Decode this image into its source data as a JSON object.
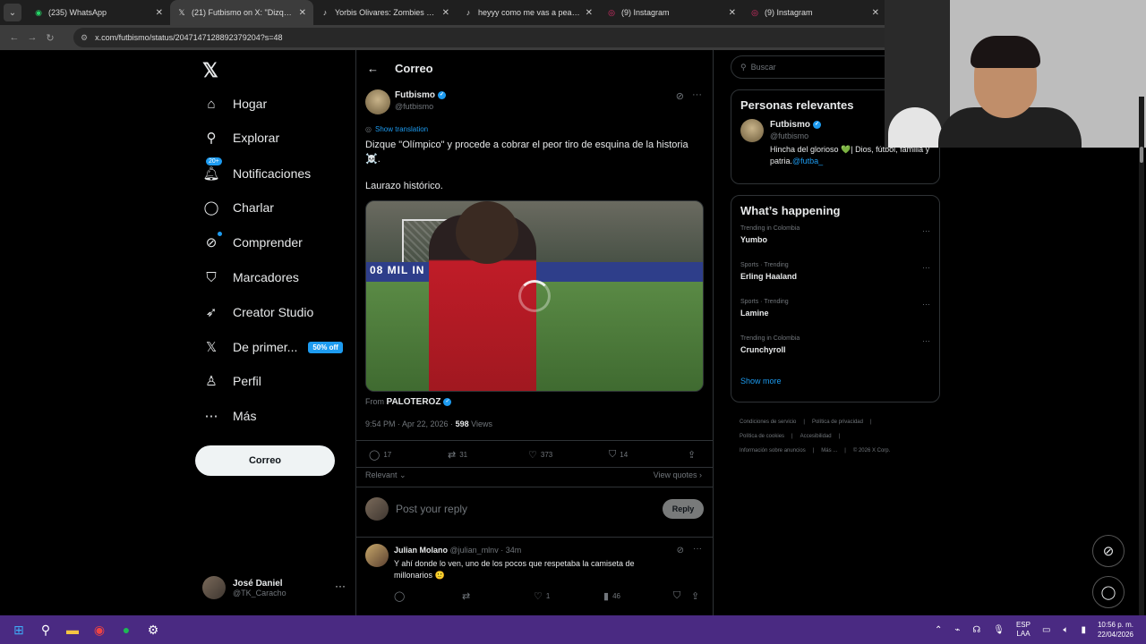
{
  "browser": {
    "tabs": [
      {
        "label": "(235) WhatsApp",
        "icon": "whatsapp-icon",
        "active": false
      },
      {
        "label": "(21) Futbismo on X: \"Dizque \"O",
        "icon": "x-icon",
        "active": true
      },
      {
        "label": "Yorbis Olivares: Zombies en la",
        "icon": "tiktok-icon",
        "active": false
      },
      {
        "label": "heyyy como me vas a pear la c",
        "icon": "tiktok-icon",
        "active": false
      },
      {
        "label": "(9) Instagram",
        "icon": "instagram-icon",
        "active": false
      },
      {
        "label": "(9) Instagram",
        "icon": "instagram-icon",
        "active": false
      }
    ],
    "url": "x.com/futbismo/status/2047147128892379204?s=48"
  },
  "nav": {
    "items": [
      {
        "label": "Hogar",
        "icon": "home-icon"
      },
      {
        "label": "Explorar",
        "icon": "search-icon"
      },
      {
        "label": "Notificaciones",
        "icon": "bell-icon",
        "badge": "20+"
      },
      {
        "label": "Charlar",
        "icon": "chat-icon"
      },
      {
        "label": "Comprender",
        "icon": "grok-icon"
      },
      {
        "label": "Marcadores",
        "icon": "bookmark-icon"
      },
      {
        "label": "Creator Studio",
        "icon": "rocket-icon"
      },
      {
        "label": "De primer...",
        "icon": "x-premium-icon",
        "badge": "50% off"
      },
      {
        "label": "Perfil",
        "icon": "person-icon"
      },
      {
        "label": "Más",
        "icon": "more-circle-icon"
      }
    ],
    "post_button": "Correo",
    "profile": {
      "name": "José Daniel",
      "handle": "@TK_Caracho"
    }
  },
  "main": {
    "header_title": "Correo",
    "author": {
      "name": "Futbismo",
      "handle": "@futbismo"
    },
    "show_translation": "Show translation",
    "text": "Dizque \"Olímpico\" y procede a cobrar el peor tiro de esquina de la historia ☠️.",
    "text2": "Laurazo histórico.",
    "media_overlay_text": "08 MIL IN DEPO",
    "from_label": "From",
    "from_name": "PALOTEROZ",
    "time": "9:54 PM · Apr 22, 2026 ·",
    "views_count": "598",
    "views_label": "Views",
    "stats": {
      "replies": "17",
      "reposts": "31",
      "likes": "373",
      "bookmarks": "14"
    },
    "sort_label": "Relevant",
    "view_quotes": "View quotes",
    "reply_placeholder": "Post your reply",
    "reply_button": "Reply",
    "reply": {
      "name": "Julian Molano",
      "handle": "@julian_mlnv · 34m",
      "text": "Y ahí donde lo ven, uno de los pocos que respetaba la camiseta de millonarios 🙂",
      "likes": "1",
      "views": "46"
    }
  },
  "right": {
    "search_placeholder": "Buscar",
    "relevant_title": "Personas relevantes",
    "person": {
      "name": "Futbismo",
      "handle": "@futbismo",
      "bio": "Hincha del glorioso 💚| Dios, fútbol, familia y patria.",
      "bio_link": "@futba_"
    },
    "happening_title": "What’s happening",
    "trends": [
      {
        "category": "Trending in Colombia",
        "title": "Yumbo"
      },
      {
        "category": "Sports · Trending",
        "title": "Erling Haaland"
      },
      {
        "category": "Sports · Trending",
        "title": "Lamine"
      },
      {
        "category": "Trending in Colombia",
        "title": "Crunchyroll"
      }
    ],
    "show_more": "Show more",
    "footer": [
      "Condiciones de servicio",
      "|",
      "Política de privacidad",
      "|",
      "Política de cookies",
      "|",
      "Accesibilidad",
      "|",
      "Información sobre anuncios",
      "|",
      "Más ...",
      "|",
      "© 2026 X Corp."
    ]
  },
  "taskbar": {
    "lang_top": "ESP",
    "lang_bottom": "LAA",
    "time": "10:56 p. m.",
    "date": "22/04/2026"
  },
  "colors": {
    "accent": "#1d9bf0",
    "taskbar": "#4a2a82"
  }
}
